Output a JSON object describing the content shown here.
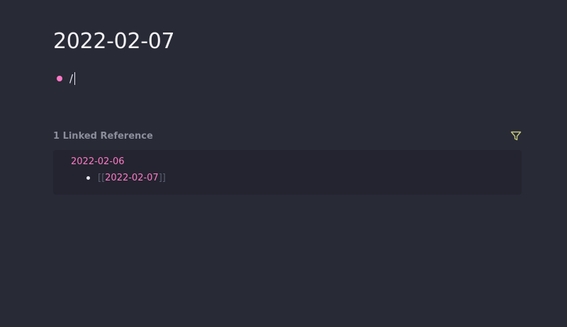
{
  "page": {
    "title": "2022-02-07"
  },
  "editor": {
    "block_text": "/",
    "bullet_color": "#ff79c6"
  },
  "linked_references": {
    "header": "1 Linked Reference",
    "filter_icon": "filter-icon",
    "items": [
      {
        "page_name": "2022-02-06",
        "block": {
          "open_brackets": "[[",
          "link_text": "2022-02-07",
          "close_brackets": "]]"
        }
      }
    ]
  },
  "colors": {
    "background": "#282a36",
    "accent": "#ff79c6",
    "filter_icon": "#c5c97a"
  }
}
